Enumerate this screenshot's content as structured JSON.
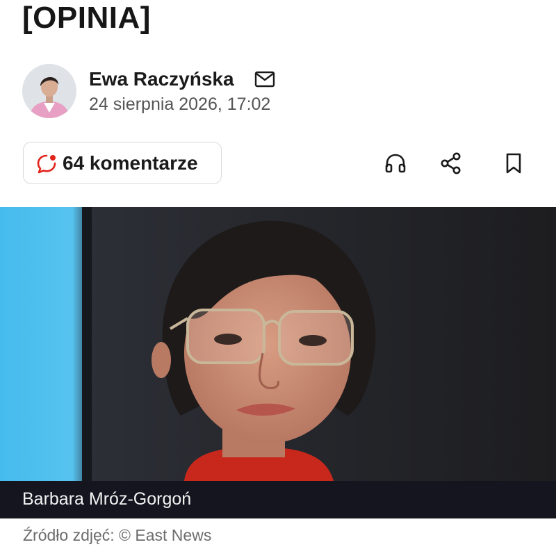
{
  "article": {
    "title": "[OPINIA]",
    "author_name": "Ewa Raczyńska",
    "date": "24 sierpnia 2026, 17:02"
  },
  "actions": {
    "comments_label": "64 komentarze",
    "icons": [
      "mail-icon",
      "comments-icon",
      "headphones-icon",
      "share-icon",
      "bookmark-icon"
    ]
  },
  "photo": {
    "caption": "Barbara Mróz-Gorgoń",
    "source": "Źródło zdjęć: © East News"
  },
  "colors": {
    "accent_red": "#e2231a",
    "caption_bar": "#151520",
    "text_dark": "#1a1a1a",
    "text_muted": "#6c6c6c"
  }
}
